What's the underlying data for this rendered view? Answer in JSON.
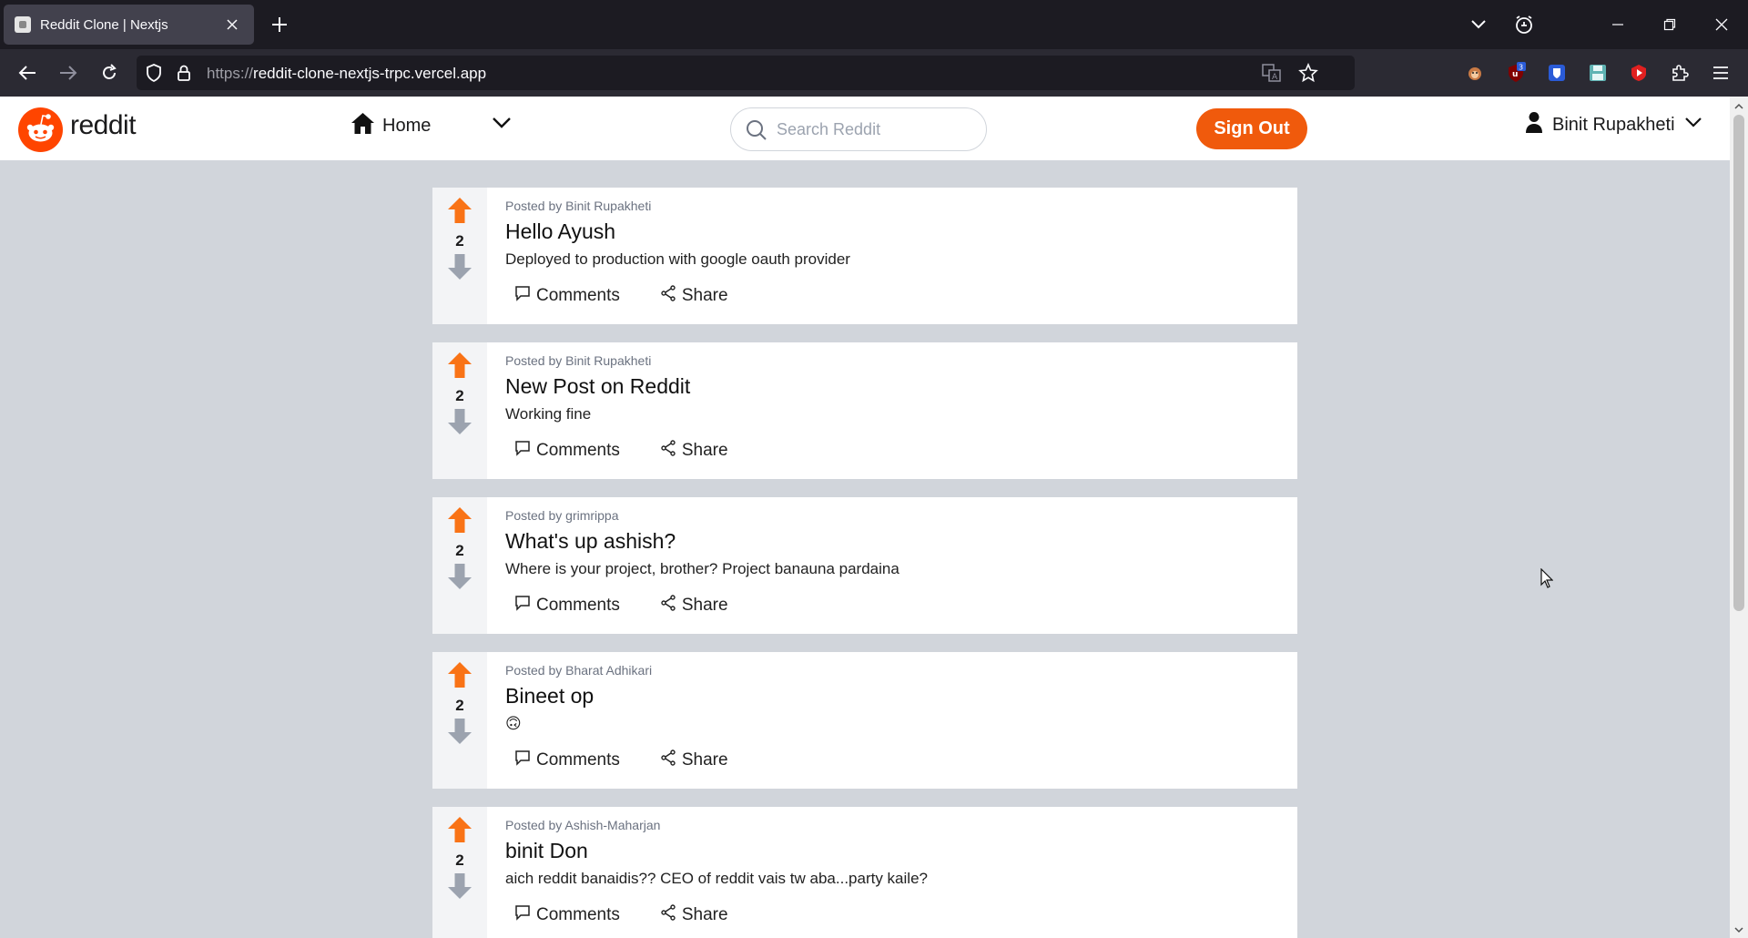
{
  "browser": {
    "tab_title": "Reddit Clone | Nextjs",
    "url_scheme": "https://",
    "url_host": "reddit-clone-nextjs-trpc.vercel.app",
    "extension_badge": "3"
  },
  "header": {
    "logo_text": "reddit",
    "home_label": "Home",
    "search_placeholder": "Search Reddit",
    "signout_label": "Sign Out",
    "user_name": "Binit Rupakheti",
    "accent_color": "#f05a0c"
  },
  "posts": [
    {
      "author": "Posted by Binit Rupakheti",
      "title": "Hello Ayush",
      "text": "Deployed to production with google oauth provider",
      "votes": "2",
      "comments_label": "Comments",
      "share_label": "Share"
    },
    {
      "author": "Posted by Binit Rupakheti",
      "title": "New Post on Reddit",
      "text": "Working fine",
      "votes": "2",
      "comments_label": "Comments",
      "share_label": "Share"
    },
    {
      "author": "Posted by grimrippa",
      "title": "What's up ashish?",
      "text": "Where is your project, brother? Project banauna pardaina",
      "votes": "2",
      "comments_label": "Comments",
      "share_label": "Share"
    },
    {
      "author": "Posted by Bharat Adhikari",
      "title": "Bineet op",
      "text": "🙃",
      "votes": "2",
      "comments_label": "Comments",
      "share_label": "Share"
    },
    {
      "author": "Posted by Ashish-Maharjan",
      "title": "binit Don",
      "text": "aich reddit banaidis?? CEO of reddit vais tw aba...party kaile?",
      "votes": "2",
      "comments_label": "Comments",
      "share_label": "Share"
    }
  ]
}
